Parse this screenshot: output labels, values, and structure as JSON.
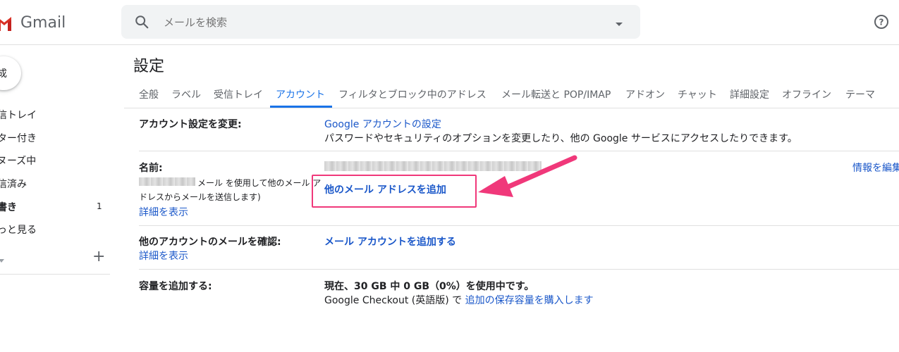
{
  "app": {
    "name": "Gmail"
  },
  "search": {
    "placeholder": "メールを検索"
  },
  "sidebar": {
    "compose_fragment": "成",
    "items": [
      {
        "label": "信トレイ"
      },
      {
        "label": "ター付き"
      },
      {
        "label": "ヌーズ中"
      },
      {
        "label": "信済み"
      },
      {
        "label": "書き",
        "count": "1"
      },
      {
        "label": "っと見る"
      }
    ],
    "labels_plus": "+"
  },
  "settings": {
    "title": "設定",
    "tabs": [
      "全般",
      "ラベル",
      "受信トレイ",
      "アカウント",
      "フィルタとブロック中のアドレス",
      "メール転送と POP/IMAP",
      "アドオン",
      "チャット",
      "詳細設定",
      "オフライン",
      "テーマ"
    ],
    "active_tab": "アカウント",
    "rows": {
      "account": {
        "label": "アカウント設定を変更:",
        "link": "Google アカウントの設定",
        "desc": "パスワードやセキュリティのオプションを変更したり、他の Google サービスにアクセスしたりできます。"
      },
      "name": {
        "label": "名前:",
        "desc_line1": "メール を使用して他のメール ア",
        "desc_line2": "ドレスからメールを送信します)",
        "details_link": "詳細を表示",
        "add_link": "他のメール アドレスを追加",
        "edit_link": "情報を編集"
      },
      "check_mail": {
        "label": "他のアカウントのメールを確認:",
        "details_link": "詳細を表示",
        "add_link": "メール アカウントを追加する"
      },
      "storage": {
        "label": "容量を追加する:",
        "usage": "現在、30 GB 中 0 GB（0%）を使用中です。",
        "desc_prefix": "Google Checkout (英語版) で ",
        "buy_link": "追加の保存容量を購入します"
      }
    }
  },
  "colors": {
    "accent": "#1a73e8",
    "link": "#1a57c9",
    "annotation": "#f0387a",
    "search_bg": "#f1f3f4"
  },
  "icons": {
    "search": "search-icon",
    "dropdown": "chevron-down-icon",
    "help": "help-icon",
    "logo": "gmail-logo"
  }
}
